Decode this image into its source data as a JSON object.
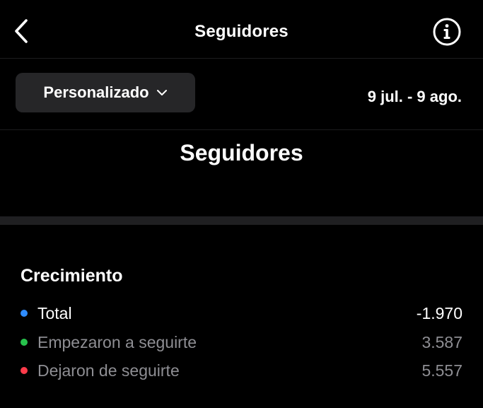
{
  "header": {
    "title": "Seguidores",
    "back_icon": "chevron-left-icon",
    "info_icon": "info-circle-icon"
  },
  "filter": {
    "period_label": "Personalizado",
    "period_icon": "chevron-down-icon",
    "date_range": "9 jul. - 9 ago."
  },
  "section": {
    "title": "Seguidores"
  },
  "growth": {
    "heading": "Crecimiento",
    "rows": [
      {
        "label": "Total",
        "value": "-1.970",
        "dot_color": "#2f8cff"
      },
      {
        "label": "Empezaron a seguirte",
        "value": "3.587",
        "dot_color": "#27c24c"
      },
      {
        "label": "Dejaron de seguirte",
        "value": "5.557",
        "dot_color": "#ff3b4a"
      }
    ]
  },
  "colors": {
    "background": "#000000",
    "dropdown_bg": "#262628",
    "divider": "#1f1f21",
    "secondary_text": "#8e8e93"
  }
}
